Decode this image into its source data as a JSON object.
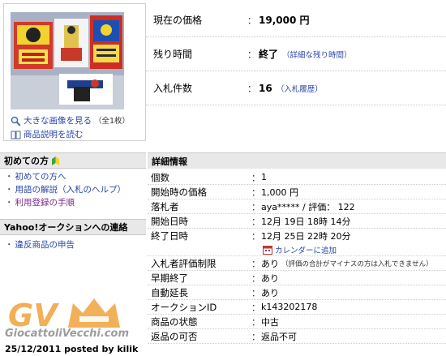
{
  "thumb": {
    "large_image_link": "大きな画像を見る",
    "image_count": "（全1枚）",
    "description_link": "商品説明を読む"
  },
  "sidebar": {
    "beginner_title": "初めての方",
    "beginner_items": [
      {
        "label": "初めての方へ"
      },
      {
        "label": "用語の解説（入札のヘルプ）"
      },
      {
        "label": "利用登録の手順"
      }
    ],
    "contact_title": "Yahoo!オークションへの連絡",
    "contact_items": [
      {
        "label": "違反商品の申告"
      }
    ]
  },
  "top_info": {
    "price_label": "現在の価格",
    "price_value": "19,000 円",
    "remaining_label": "残り時間",
    "remaining_value": "終了",
    "remaining_link": "（詳細な残り時間）",
    "bids_label": "入札件数",
    "bids_value": "16",
    "bids_link": "（入札履歴）",
    "colon": "："
  },
  "detail": {
    "title": "詳細情報",
    "rows": [
      {
        "label": "個数",
        "value": "1"
      },
      {
        "label": "開始時の価格",
        "value": "1,000 円"
      },
      {
        "label": "落札者",
        "value": "aya***** / 評価： 122"
      },
      {
        "label": "開始日時",
        "value": "12月 19日 18時 14分"
      },
      {
        "label": "終了日時",
        "value": "12月 25日 22時 20分"
      }
    ],
    "calendar_link": "カレンダーに追加",
    "rows2": [
      {
        "label": "入札者評価制限",
        "value": "あり",
        "note": "（評価の合計がマイナスの方は入札できません）"
      },
      {
        "label": "早期終了",
        "value": "あり"
      },
      {
        "label": "自動延長",
        "value": "あり"
      },
      {
        "label": "オークションID",
        "value": "k143202178"
      },
      {
        "label": "商品の状態",
        "value": "中古"
      },
      {
        "label": "返品の可否",
        "value": "返品不可"
      }
    ]
  },
  "watermark": {
    "logo_text": "GV",
    "site": "GiocattoliVecchi.com",
    "posted": "25/12/2011 posted by kilik"
  },
  "colors": {
    "link": "#2a45a8",
    "section_bg": "#e8e8e8",
    "watermark_orange": "#f0a23c"
  }
}
